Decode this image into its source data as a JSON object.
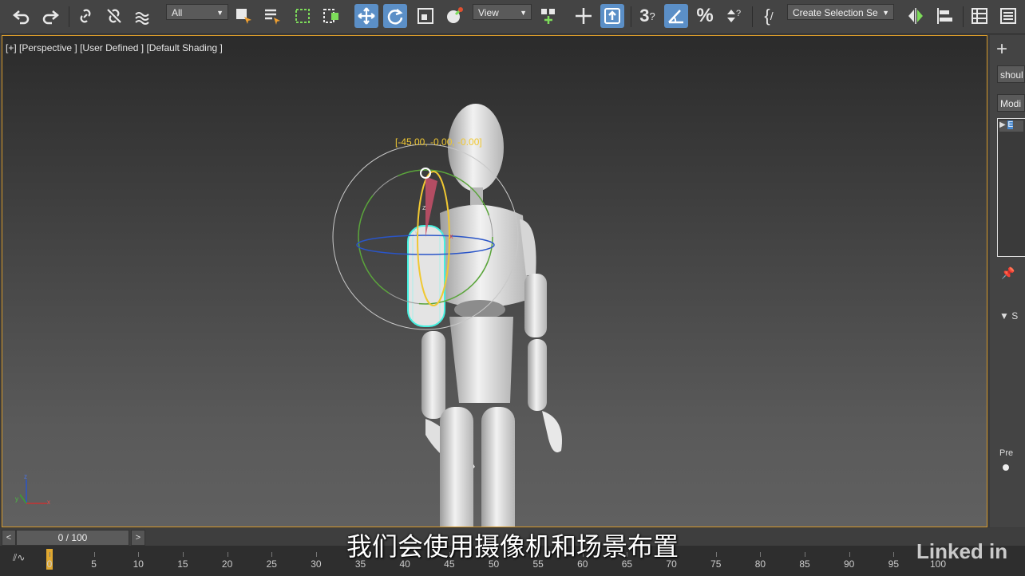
{
  "toolbar": {
    "selection_filter": "All",
    "reference_coord": "View",
    "named_selection": "Create Selection Se"
  },
  "viewport": {
    "label_plus": "[+]",
    "label_view": "[Perspective ]",
    "label_mode": "[User Defined ]",
    "label_shading": "[Default Shading ]",
    "rotate_readout": "[-45.00, -0.00, -0.00]",
    "gizmo_axes": {
      "x": "x",
      "y": "y",
      "z": "z"
    }
  },
  "command_panel": {
    "object_name": "shoul",
    "modifier_list": "Modi",
    "rollout_1": "S",
    "rollout_2": "Pre",
    "rollout_3": "S",
    "rollout_4": "E"
  },
  "timeline": {
    "frame_display": "0 / 100",
    "prev": "<",
    "next": ">",
    "ticks": [
      "0",
      "5",
      "10",
      "15",
      "20",
      "25",
      "30",
      "35",
      "40",
      "45",
      "50",
      "55",
      "60",
      "65",
      "70",
      "75",
      "80",
      "85",
      "90",
      "95",
      "100"
    ]
  },
  "subtitle": "我们会使用摄像机和场景布置",
  "watermark": "Linked in"
}
